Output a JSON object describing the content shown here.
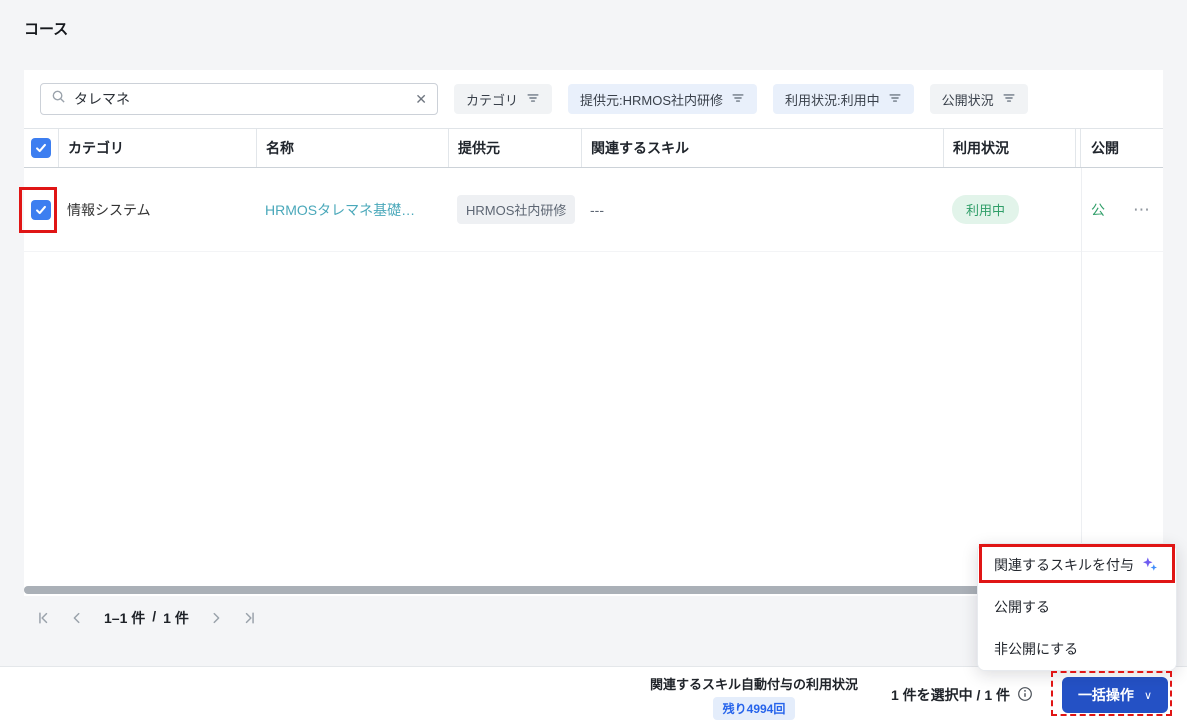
{
  "page_title": "コース",
  "toolbar": {
    "search": {
      "value": "タレマネ"
    },
    "filters": [
      {
        "label": "カテゴリ",
        "active": false
      },
      {
        "label": "提供元:HRMOS社内研修",
        "active": true
      },
      {
        "label": "利用状況:利用中",
        "active": true
      },
      {
        "label": "公開状況",
        "active": false
      }
    ]
  },
  "table": {
    "columns": [
      "カテゴリ",
      "名称",
      "提供元",
      "関連するスキル",
      "利用状況",
      "公開"
    ],
    "row": {
      "category": "情報システム",
      "name": "HRMOSタレマネ基礎…",
      "provider": "HRMOS社内研修",
      "skills": "---",
      "usage": "利用中",
      "publish": "公"
    }
  },
  "pagination": {
    "range": "1–1 件",
    "separator": "/",
    "total": "1 件"
  },
  "menu": {
    "items": [
      {
        "label": "関連するスキルを付与",
        "ai": true
      },
      {
        "label": "公開する",
        "ai": false
      },
      {
        "label": "非公開にする",
        "ai": false
      }
    ]
  },
  "footer": {
    "usage_title": "関連するスキル自動付与の利用状況",
    "usage_remaining": "残り4994回",
    "selection": "1 件を選択中 / 1 件",
    "bulk_label": "一括操作"
  },
  "icons": {
    "search": "magnifier",
    "clear": "✕",
    "filter": "filter-lines",
    "check": "checkmark",
    "actions": "⋯",
    "chevron_down": "∨",
    "info": "info-circle",
    "ai_sparkle": "sparkles",
    "first_page": "|<",
    "prev_page": "<",
    "next_page": ">",
    "last_page": ">|"
  },
  "colors": {
    "accent_blue": "#2451c5",
    "checkbox_blue": "#3d7ef0",
    "link_teal": "#4aa8ba",
    "success_green": "#2f9e68",
    "success_bg": "#e2f4ea",
    "remaining_text": "#2563eb",
    "remaining_bg": "#e4edfb",
    "annotation_red": "#e01515"
  }
}
